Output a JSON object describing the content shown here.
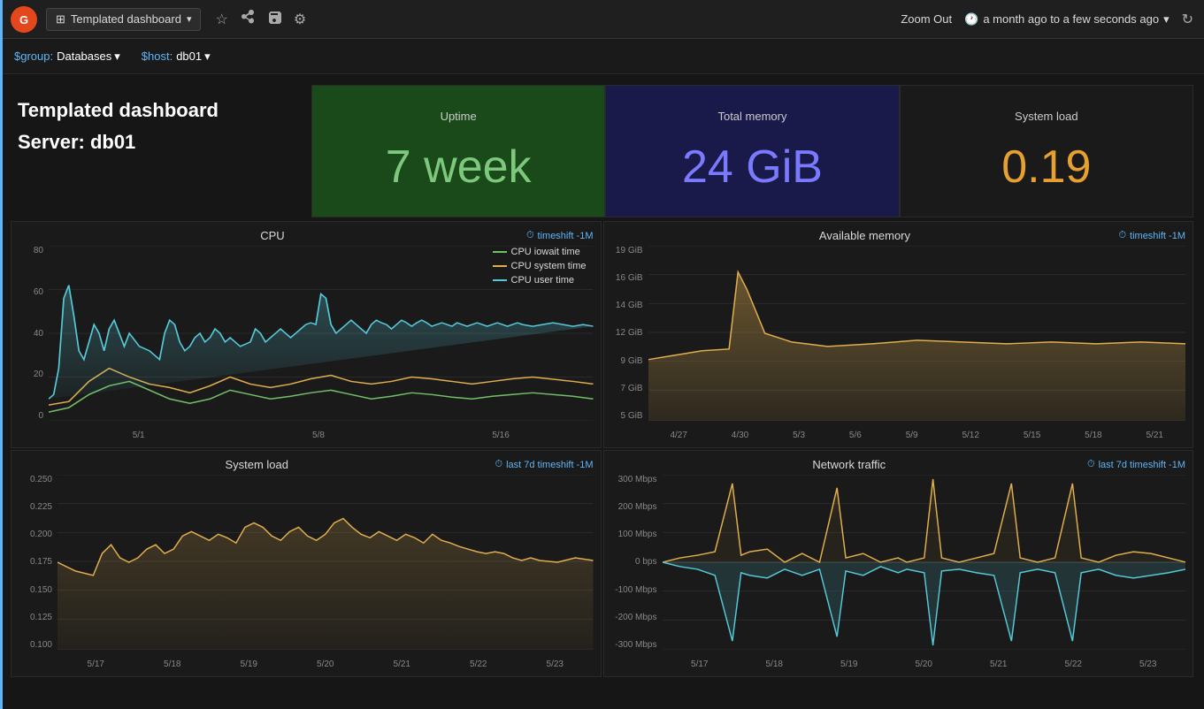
{
  "topbar": {
    "logo": "G",
    "dashboard_label": "Templated dashboard",
    "dropdown_arrow": "▾",
    "star_icon": "★",
    "share_icon": "⤴",
    "save_icon": "💾",
    "settings_icon": "⚙",
    "zoom_out": "Zoom Out",
    "time_range": "a month ago to a few seconds ago",
    "clock_icon": "🕐",
    "refresh_icon": "↻"
  },
  "filterbar": {
    "group_label": "$group:",
    "group_value": "Databases",
    "host_label": "$host:",
    "host_value": "db01"
  },
  "dashboard": {
    "title": "Templated dashboard",
    "server": "Server: db01"
  },
  "uptime": {
    "title": "Uptime",
    "value": "7 week"
  },
  "total_memory": {
    "title": "Total memory",
    "value": "24 GiB"
  },
  "system_load_stat": {
    "title": "System load",
    "value": "0.19"
  },
  "cpu_chart": {
    "title": "CPU",
    "timeshift": "timeshift -1M",
    "legend": [
      {
        "label": "CPU iowait time",
        "color": "#73bf69"
      },
      {
        "label": "CPU system time",
        "color": "#e0ae4e"
      },
      {
        "label": "CPU user time",
        "color": "#56c8d8"
      }
    ],
    "y_labels": [
      "80",
      "60",
      "40",
      "20",
      "0"
    ],
    "x_labels": [
      "5/1",
      "5/8",
      "5/16"
    ]
  },
  "memory_chart": {
    "title": "Available memory",
    "timeshift": "timeshift -1M",
    "y_labels": [
      "19 GiB",
      "16 GiB",
      "14 GiB",
      "12 GiB",
      "9 GiB",
      "7 GiB",
      "5 GiB"
    ],
    "x_labels": [
      "4/27",
      "4/30",
      "5/3",
      "5/6",
      "5/9",
      "5/12",
      "5/15",
      "5/18",
      "5/21"
    ]
  },
  "sysload_chart": {
    "title": "System load",
    "timeshift": "last 7d timeshift -1M",
    "y_labels": [
      "0.250",
      "0.225",
      "0.200",
      "0.175",
      "0.150",
      "0.125",
      "0.100"
    ],
    "x_labels": [
      "5/17",
      "5/18",
      "5/19",
      "5/20",
      "5/21",
      "5/22",
      "5/23"
    ]
  },
  "network_chart": {
    "title": "Network traffic",
    "timeshift": "last 7d timeshift -1M",
    "y_labels": [
      "300 Mbps",
      "200 Mbps",
      "100 Mbps",
      "0 bps",
      "-100 Mbps",
      "-200 Mbps",
      "-300 Mbps"
    ],
    "x_labels": [
      "5/17",
      "5/18",
      "5/19",
      "5/20",
      "5/21",
      "5/22",
      "5/23"
    ]
  }
}
